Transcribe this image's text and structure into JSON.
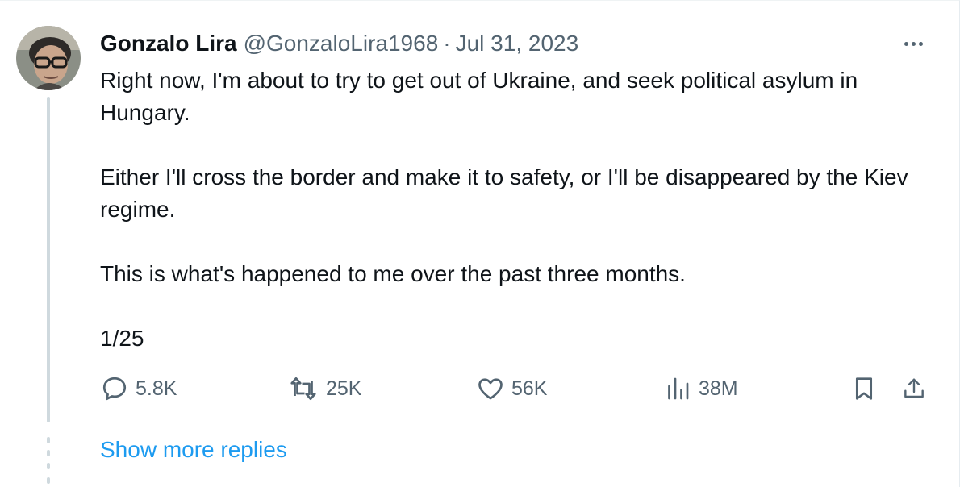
{
  "tweet": {
    "author_name": "Gonzalo Lira",
    "handle": "@GonzaloLira1968",
    "separator": "·",
    "date": "Jul 31, 2023",
    "paragraphs": [
      "Right now, I'm about to try to get out of Ukraine, and seek political asylum in Hungary.",
      "Either I'll cross the border and make it to safety, or I'll be disappeared by the Kiev regime.",
      "This is what's happened to me over the past three months.",
      "1/25"
    ]
  },
  "actions": {
    "replies": "5.8K",
    "reposts": "25K",
    "likes": "56K",
    "views": "38M"
  },
  "icons": {
    "reply": "reply-icon",
    "repost": "repost-icon",
    "like": "heart-icon",
    "views": "views-icon",
    "bookmark": "bookmark-icon",
    "share": "share-icon",
    "more": "more-icon"
  },
  "show_more_replies": "Show more replies",
  "colors": {
    "text": "#0f1419",
    "secondary": "#536471",
    "link": "#1d9bf0",
    "thread_line": "#cfd9de"
  }
}
